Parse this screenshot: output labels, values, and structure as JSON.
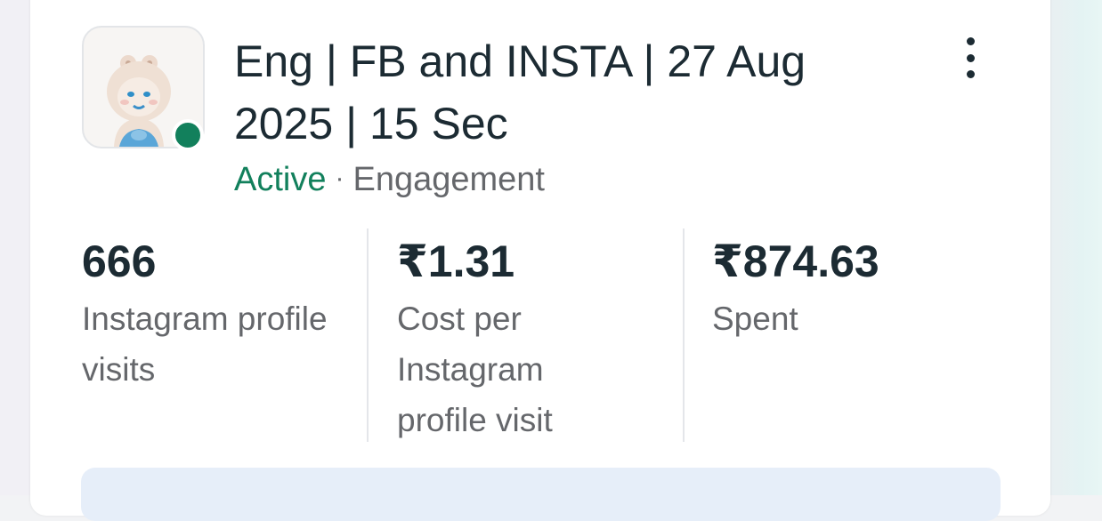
{
  "campaign": {
    "title": "Eng | FB and INSTA | 27 Aug 2025 | 15 Sec",
    "status": "Active",
    "separator": "·",
    "objective": "Engagement"
  },
  "metrics": [
    {
      "value": "666",
      "label": "Instagram profile visits"
    },
    {
      "value": "₹1.31",
      "label": "Cost per Instagram profile visit"
    },
    {
      "value": "₹874.63",
      "label": "Spent"
    }
  ],
  "colors": {
    "active_green": "#12805c",
    "text_primary": "#1c2b33",
    "text_secondary": "#65676b",
    "banner_bg": "#e6eef9"
  },
  "icons": {
    "more": "more-vertical-icon",
    "thumbnail": "ad-creative-thumbnail"
  }
}
